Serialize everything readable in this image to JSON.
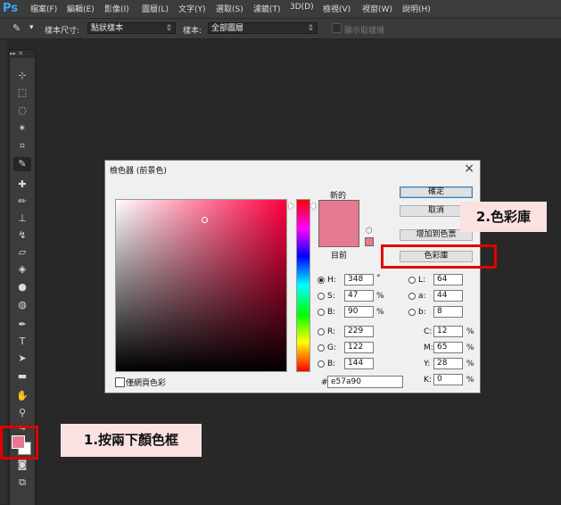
{
  "menubar": {
    "logo": "Ps",
    "items": [
      "檔案(F)",
      "編輯(E)",
      "影像(I)",
      "圖層(L)",
      "文字(Y)",
      "選取(S)",
      "濾鏡(T)",
      "3D(D)",
      "檢視(V)",
      "視窗(W)",
      "說明(H)"
    ]
  },
  "options": {
    "sample_size_label": "樣本尺寸:",
    "sample_size_value": "點狀樣本",
    "sample_label": "樣本:",
    "sample_value": "全部圖層",
    "show_ring_label": "顯示取樣環"
  },
  "toolbox": {
    "header": "▸▸ ✕"
  },
  "dialog": {
    "title": "檢色器 (前景色)",
    "new_label": "新的",
    "current_label": "目前",
    "ok": "確定",
    "cancel": "取消",
    "add_to_swatches": "增加到色票",
    "color_libraries": "色彩庫",
    "web_only": "僅網頁色彩",
    "hex_prefix": "#",
    "hex": "e57a90",
    "fields": {
      "H": "348",
      "S": "47",
      "B": "90",
      "R": "229",
      "G": "122",
      "Bl": "144",
      "L": "64",
      "a": "44",
      "b": "8",
      "C": "12",
      "M": "65",
      "Y": "28",
      "K": "0"
    },
    "labels": {
      "H": "H:",
      "S": "S:",
      "B": "B:",
      "R": "R:",
      "G": "G:",
      "Bl": "B:",
      "L": "L:",
      "a": "a:",
      "b": "b:",
      "C": "C:",
      "M": "M:",
      "Y": "Y:",
      "K": "K:"
    },
    "units": {
      "deg": "°",
      "pct": "%"
    }
  },
  "colors": {
    "foreground": "#e57a90",
    "background": "#ffffff",
    "annotation_red": "#e00000"
  },
  "annotations": {
    "step1": "1.按兩下顏色框",
    "step2": "2.色彩庫"
  }
}
